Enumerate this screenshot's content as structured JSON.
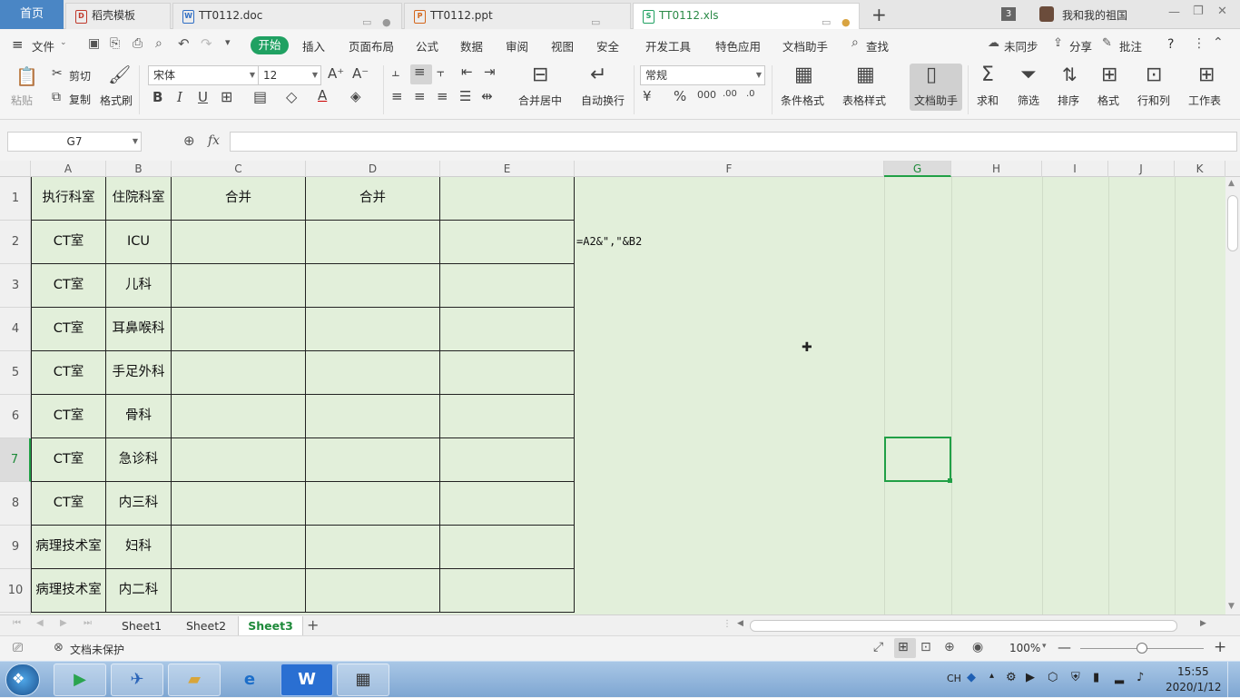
{
  "tabs": {
    "home": "首页",
    "items": [
      {
        "label": "稻壳模板",
        "icon": "D"
      },
      {
        "label": "TT0112.doc",
        "icon": "W"
      },
      {
        "label": "TT0112.ppt",
        "icon": "P"
      },
      {
        "label": "TT0112.xls",
        "icon": "S"
      }
    ],
    "add": "+",
    "badge": "3",
    "user": "我和我的祖国"
  },
  "menu": {
    "file": "文件",
    "start": "开始",
    "items": [
      "插入",
      "页面布局",
      "公式",
      "数据",
      "审阅",
      "视图",
      "安全",
      "开发工具",
      "特色应用",
      "文档助手"
    ],
    "search": "查找",
    "sync": "未同步",
    "share": "分享",
    "comment": "批注",
    "help": "?"
  },
  "ribbon": {
    "paste": "粘贴",
    "cut": "剪切",
    "copy": "复制",
    "format_painter": "格式刷",
    "font_name": "宋体",
    "font_size": "12",
    "merge_center": "合并居中",
    "auto_wrap": "自动换行",
    "number_format": "常规",
    "conditional_format": "条件格式",
    "table_style": "表格样式",
    "doc_assistant": "文档助手",
    "sum": "求和",
    "filter": "筛选",
    "sort": "排序",
    "format": "格式",
    "row_col": "行和列",
    "worksheet": "工作表"
  },
  "formula_bar": {
    "name_box": "G7",
    "fx": "fx",
    "value": ""
  },
  "columns": [
    "A",
    "B",
    "C",
    "D",
    "E",
    "F",
    "G",
    "H",
    "I",
    "J",
    "K"
  ],
  "rows": [
    "1",
    "2",
    "3",
    "4",
    "5",
    "6",
    "7",
    "8",
    "9",
    "10"
  ],
  "table": {
    "header": [
      "执行科室",
      "住院科室",
      "合并",
      "合并",
      ""
    ],
    "rows": [
      [
        "CT室",
        "ICU",
        "",
        "",
        ""
      ],
      [
        "CT室",
        "儿科",
        "",
        "",
        ""
      ],
      [
        "CT室",
        "耳鼻喉科",
        "",
        "",
        ""
      ],
      [
        "CT室",
        "手足外科",
        "",
        "",
        ""
      ],
      [
        "CT室",
        "骨科",
        "",
        "",
        ""
      ],
      [
        "CT室",
        "急诊科",
        "",
        "",
        ""
      ],
      [
        "CT室",
        "内三科",
        "",
        "",
        ""
      ],
      [
        "病理技术室",
        "妇科",
        "",
        "",
        ""
      ],
      [
        "病理技术室",
        "内二科",
        "",
        "",
        ""
      ]
    ]
  },
  "formula_text": "=A2&\",\"&B2",
  "sheets": [
    "Sheet1",
    "Sheet2",
    "Sheet3"
  ],
  "active_sheet": "Sheet3",
  "status": {
    "protect": "文档未保护",
    "zoom": "100%",
    "zoom_level": 0.5
  },
  "taskbar": {
    "lang": "CH",
    "time": "15:55",
    "date": "2020/1/12"
  },
  "colors": {
    "accent": "#20a162",
    "sheet_bg": "#e2efda",
    "selection": "#21a046",
    "home_tab": "#4a86c5"
  }
}
